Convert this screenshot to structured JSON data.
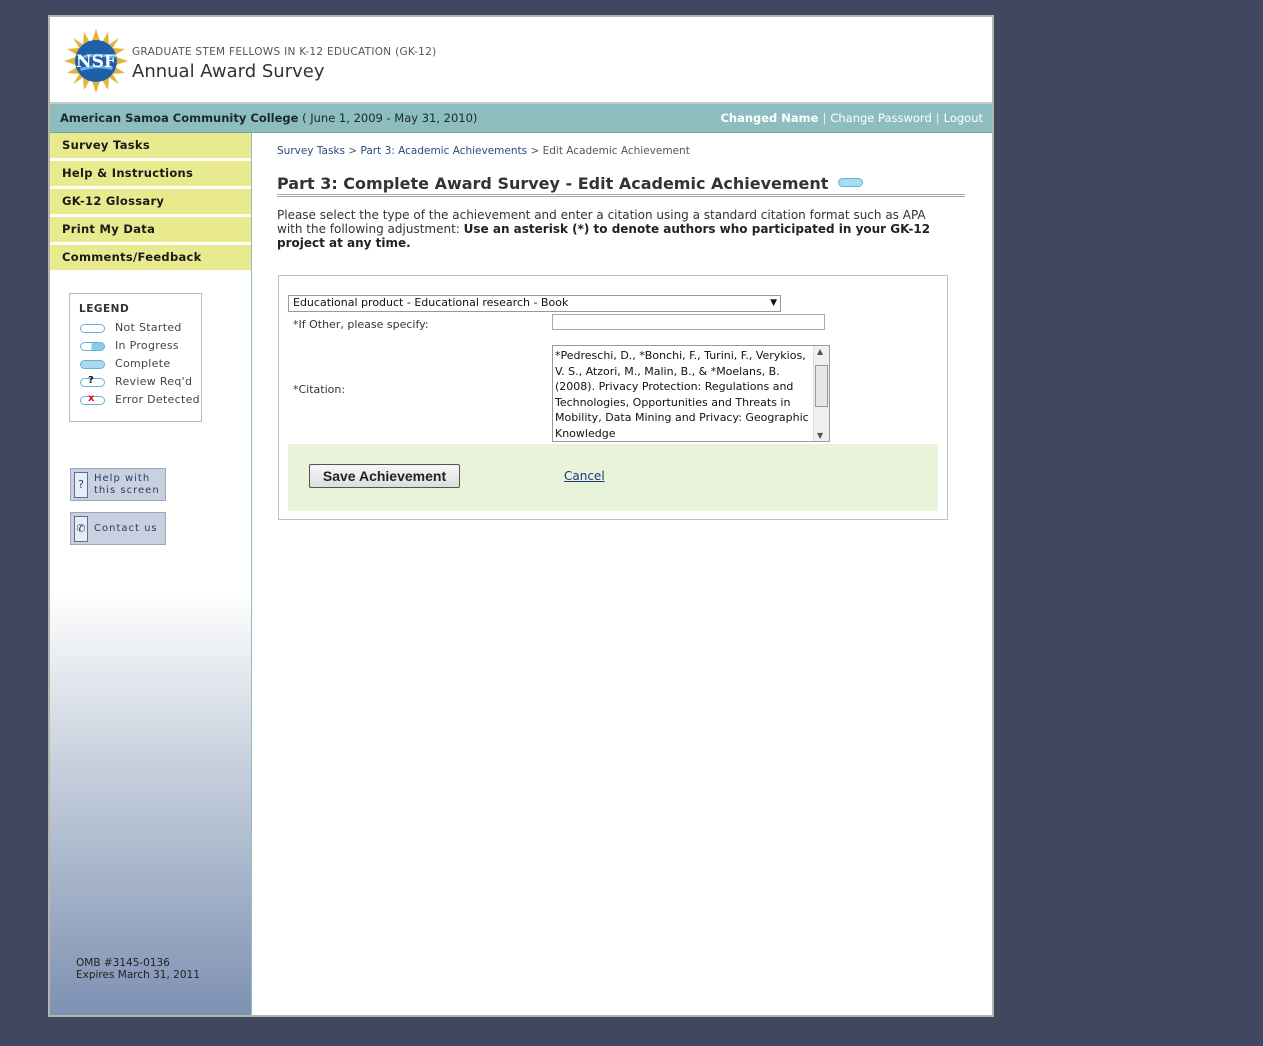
{
  "header": {
    "subtitle": "GRADUATE STEM FELLOWS IN K-12 EDUCATION (GK-12)",
    "title": "Annual Award Survey",
    "logo_text": "NSF"
  },
  "bar": {
    "institution": "American Samoa Community College",
    "period": "( June 1, 2009 - May 31, 2010)",
    "user_name": "Changed Name",
    "change_password": "Change Password",
    "logout": "Logout",
    "separator": "|"
  },
  "sidebar": {
    "nav": [
      {
        "label": "Survey Tasks"
      },
      {
        "label": "Help & Instructions"
      },
      {
        "label": "GK-12 Glossary"
      },
      {
        "label": "Print My Data"
      },
      {
        "label": "Comments/Feedback"
      }
    ],
    "legend": {
      "title": "LEGEND",
      "items": [
        {
          "label": "Not Started",
          "icon": "not-started-icon"
        },
        {
          "label": "In Progress",
          "icon": "in-progress-icon"
        },
        {
          "label": "Complete",
          "icon": "complete-icon"
        },
        {
          "label": "Review Req'd",
          "icon": "review-icon",
          "mark": "?"
        },
        {
          "label": "Error Detected",
          "icon": "error-icon",
          "mark": "x"
        }
      ]
    },
    "help_button": {
      "line1": "Help with",
      "line2": "this screen",
      "icon": "?"
    },
    "contact_button": {
      "label": "Contact us"
    },
    "omb": {
      "line1": "OMB #3145-0136",
      "line2": "Expires March 31, 2011"
    }
  },
  "main": {
    "breadcrumb": {
      "items": [
        "Survey Tasks",
        "Part 3: Academic Achievements",
        "Edit Academic Achievement"
      ],
      "separator": ">"
    },
    "page_title": "Part 3: Complete Award Survey - Edit Academic Achievement",
    "intro_text": "Please select the type of the achievement and enter a citation using a standard citation format such as APA with the following adjustment: ",
    "intro_bold": "Use an asterisk (*) to denote authors who participated in your GK-12 project at any time.",
    "form": {
      "type_selected": "Educational product - Educational research - Book",
      "other_label": "*If Other, please specify:",
      "other_value": "",
      "citation_label": "*Citation:",
      "citation_value": "*Pedreschi, D., *Bonchi, F., Turini, F., Verykios, V. S., Atzori, M., Malin, B., & *Moelans, B. (2008). Privacy Protection: Regulations and Technologies, Opportunities and Threats in Mobility, Data Mining and Privacy: Geographic Knowledge",
      "save_label": "Save Achievement",
      "cancel_label": "Cancel"
    }
  },
  "colors": {
    "background": "#404860",
    "nav_bg": "#e9e98d",
    "bar_bg": "#8dbdbe",
    "action_bg": "#e8f3d9"
  }
}
